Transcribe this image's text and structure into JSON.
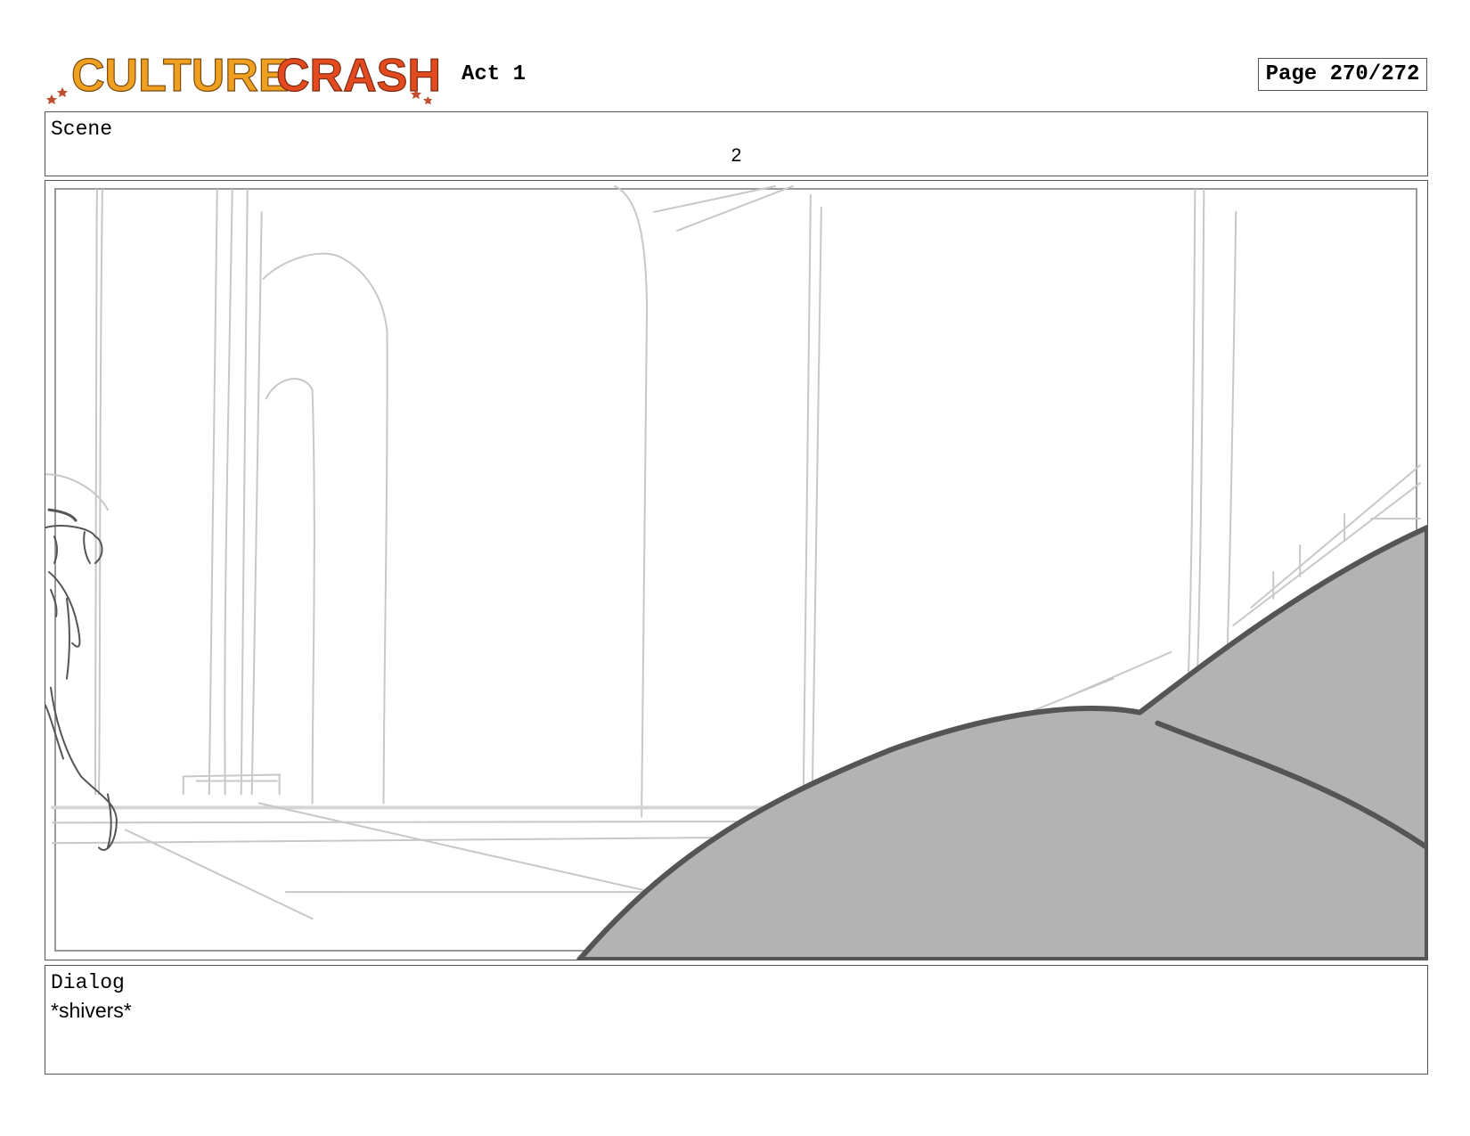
{
  "header": {
    "logo_text_1": "CULTURE",
    "logo_text_2": "CRASH",
    "act_label": "Act 1",
    "page_label": "Page 270/272"
  },
  "scene": {
    "label": "Scene",
    "number": "2"
  },
  "dialog": {
    "label": "Dialog",
    "text": "*shivers*"
  },
  "colors": {
    "logo_orange": "#f0a020",
    "logo_red": "#e44a20",
    "sketch_line": "#c8c8c8",
    "silhouette_fill": "#b3b3b3",
    "silhouette_stroke": "#555555"
  }
}
